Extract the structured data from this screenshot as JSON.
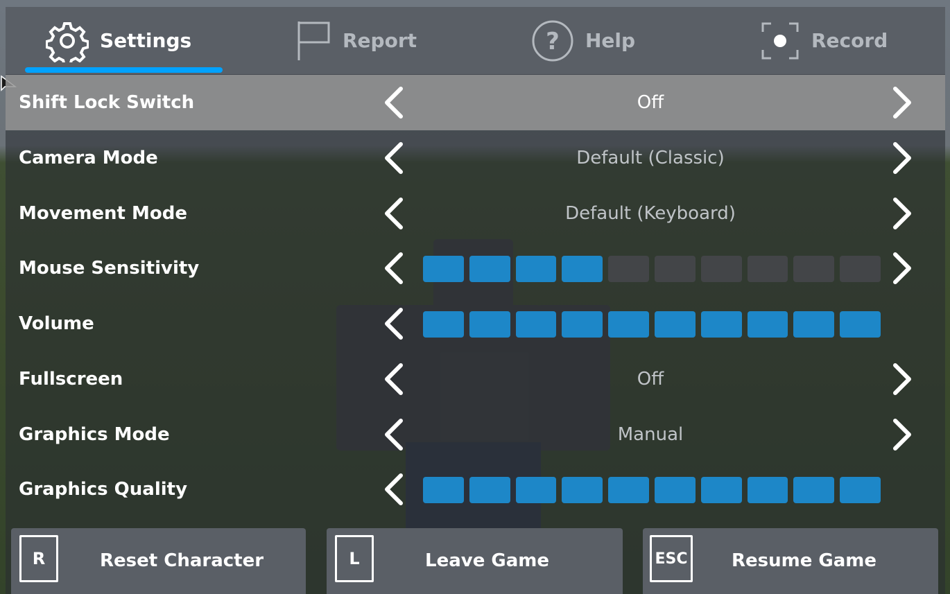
{
  "tabs": [
    {
      "label": "Settings",
      "icon": "gear-icon",
      "active": true
    },
    {
      "label": "Report",
      "icon": "flag-icon",
      "active": false
    },
    {
      "label": "Help",
      "icon": "help-icon",
      "active": false
    },
    {
      "label": "Record",
      "icon": "record-icon",
      "active": false
    }
  ],
  "settings": {
    "shift_lock": {
      "label": "Shift Lock Switch",
      "value": "Off"
    },
    "camera_mode": {
      "label": "Camera Mode",
      "value": "Default (Classic)"
    },
    "movement_mode": {
      "label": "Movement Mode",
      "value": "Default (Keyboard)"
    },
    "mouse_sensitivity": {
      "label": "Mouse Sensitivity",
      "level": 4,
      "max": 10
    },
    "volume": {
      "label": "Volume",
      "level": 10,
      "max": 10
    },
    "fullscreen": {
      "label": "Fullscreen",
      "value": "Off"
    },
    "graphics_mode": {
      "label": "Graphics Mode",
      "value": "Manual"
    },
    "graphics_quality": {
      "label": "Graphics Quality",
      "level": 10,
      "max": 10
    }
  },
  "actions": {
    "reset": {
      "key": "R",
      "label": "Reset Character"
    },
    "leave": {
      "key": "L",
      "label": "Leave Game"
    },
    "resume": {
      "key": "ESC",
      "label": "Resume Game"
    }
  },
  "colors": {
    "accent": "#00a2ff",
    "slider_on": "#1d87c8",
    "slider_off": "#46484c",
    "panel": "#5a5f66"
  }
}
